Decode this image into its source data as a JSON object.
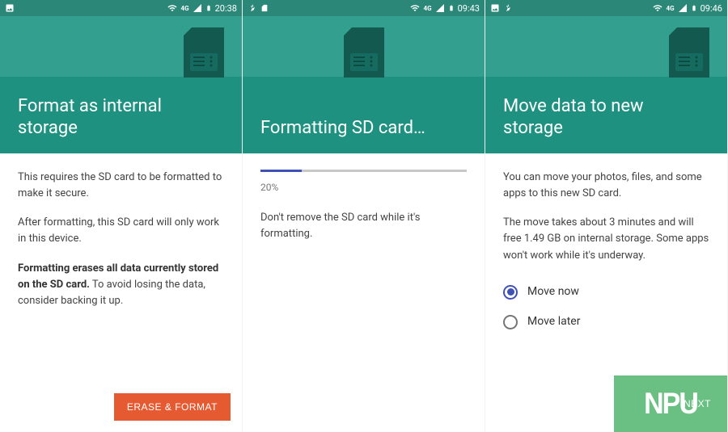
{
  "screens": [
    {
      "status": {
        "left_icons": [
          "image"
        ],
        "network_tag": "4G",
        "time": "20:38"
      },
      "title": "Format as internal storage",
      "p1": "This requires the SD card to be formatted to make it secure.",
      "p2": "After formatting, this SD card will only work in this device.",
      "p3_bold": "Formatting erases all data currently stored on the SD card.",
      "p3_rest": " To avoid losing the data, consider backing it up.",
      "primary_btn": "ERASE & FORMAT"
    },
    {
      "status": {
        "left_icons": [
          "pinwheel",
          "sd"
        ],
        "network_tag": "4G",
        "time": "09:43"
      },
      "title": "Formatting SD card…",
      "progress_pct": "20%",
      "progress_value": 20,
      "p1": "Don't remove the SD card while it's formatting."
    },
    {
      "status": {
        "left_icons": [
          "image",
          "pinwheel"
        ],
        "network_tag": "4G",
        "time": "09:46"
      },
      "title": "Move data to new storage",
      "p1": "You can move your photos, files, and some apps to this new SD card.",
      "p2": "The move takes about 3 minutes and will free 1.49 GB on internal storage. Some apps won't work while it's underway.",
      "radio": [
        {
          "label": "Move now",
          "checked": true
        },
        {
          "label": "Move later",
          "checked": false
        }
      ],
      "next_btn": "NEXT"
    }
  ],
  "watermark": "NPU"
}
